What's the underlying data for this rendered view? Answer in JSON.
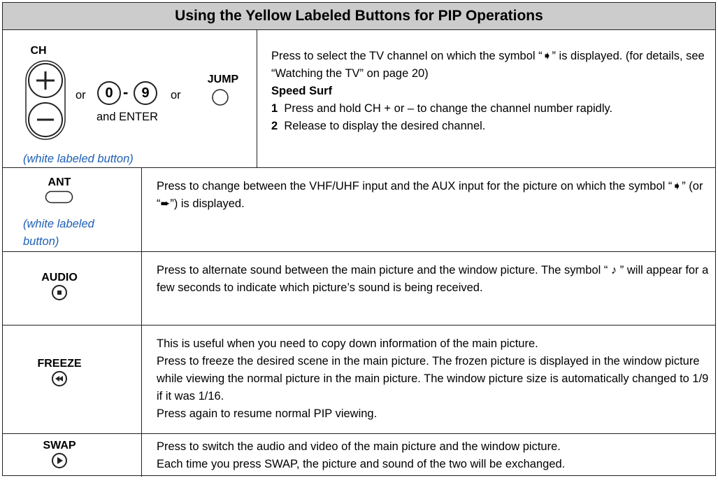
{
  "header": {
    "title": "Using the Yellow Labeled Buttons for PIP Operations"
  },
  "ch_row": {
    "ch_label": "CH",
    "plus_symbol": "+",
    "minus_symbol": "–",
    "or1": "or",
    "digit0": "0",
    "dash": "-",
    "digit9": "9",
    "or2": "or",
    "and_enter": "and ENTER",
    "jump_label": "JUMP",
    "note": "(white labeled button)",
    "desc_line1": "Press to select the TV channel on which the symbol “➧” is displayed. (for details, see “Watching the TV” on page 20)",
    "speed_surf_title": "Speed Surf",
    "step1_num": "1",
    "step1_text": "Press and hold CH + or – to change the channel number rapidly.",
    "step2_num": "2",
    "step2_text": "Release to display the desired channel."
  },
  "ant_row": {
    "label": "ANT",
    "note": "(white labeled button)",
    "desc": "Press to change between the VHF/UHF input and the AUX input for the picture on which the symbol “➧” (or “➨”) is displayed."
  },
  "audio_row": {
    "label": "AUDIO",
    "desc": "Press to alternate sound between the main picture and the window picture. The symbol “ ♪ ” will appear for a few seconds to indicate which picture’s sound is being received."
  },
  "freeze_row": {
    "label": "FREEZE",
    "desc_lines": [
      "This is useful when you need to copy down information of the main picture.",
      "Press to freeze the desired scene in the main picture. The frozen picture is displayed in the window picture while viewing the normal picture in the main picture.  The window picture size is automatically changed to 1/9 if it was 1/16.",
      "Press again to resume normal PIP viewing."
    ]
  },
  "swap_row": {
    "label": "SWAP",
    "desc_lines": [
      "Press to switch the audio and video of the main picture and the window picture.",
      "Each time you press SWAP, the picture and sound of the two will be exchanged."
    ]
  },
  "icons": {
    "audio_button": "square-stop-button-icon",
    "freeze_button": "rewind-button-icon",
    "swap_button": "play-button-icon",
    "ant_button": "oval-button-icon",
    "jump_button": "round-button-icon"
  },
  "colors": {
    "header_bg": "#cccccc",
    "note_blue": "#1f5fb5"
  }
}
